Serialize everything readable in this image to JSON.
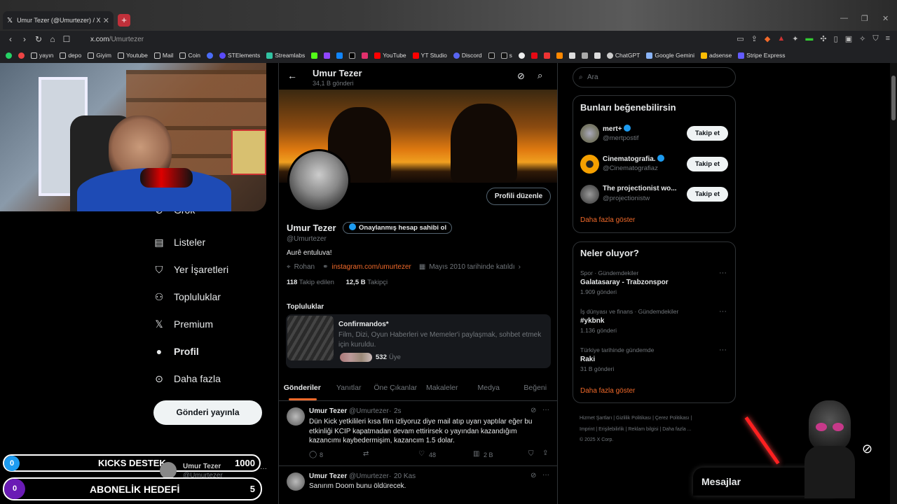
{
  "browser": {
    "tab_title": "Umur Tezer (@Umurtezer) / X",
    "tab_close": "✕",
    "new_tab": "+",
    "url_host": "x.com",
    "url_path": "/Umurtezer",
    "bookmarks": [
      "yayın",
      "depo",
      "Giyim",
      "Youtube",
      "Mail",
      "Coin",
      "STElements",
      "Streamlabs",
      "YouTube",
      "YT Studio",
      "Discord",
      "s",
      "ChatGPT",
      "Google Gemini",
      "adsense",
      "Stripe Express"
    ]
  },
  "nav": {
    "items": [
      {
        "label": "Grok",
        "icon": "grok-icon"
      },
      {
        "label": "Listeler",
        "icon": "list-icon"
      },
      {
        "label": "Yer İşaretleri",
        "icon": "bookmark-icon"
      },
      {
        "label": "Topluluklar",
        "icon": "communities-icon"
      },
      {
        "label": "Premium",
        "icon": "x-logo-icon"
      },
      {
        "label": "Profil",
        "icon": "profile-icon"
      },
      {
        "label": "Daha fazla",
        "icon": "more-icon"
      }
    ],
    "post_button": "Gönderi yayınla"
  },
  "overlay": {
    "kicks_label": "KICKS DESTEK",
    "kicks_current": "0",
    "kicks_goal": "1000",
    "sub_label": "ABONELİK HEDEFİ",
    "sub_current": "0",
    "sub_goal": "5",
    "account_name": "Umur Tezer",
    "account_handle": "@Umurtezer"
  },
  "profile": {
    "header_name": "Umur Tezer",
    "header_posts": "34,1 B gönderi",
    "name": "Umur Tezer",
    "verify_badge": "Onaylanmış hesap sahibi ol",
    "handle": "@Umurtezer",
    "bio": "Aurê entuluva!",
    "location": "Rohan",
    "link": "instagram.com/umurtezer",
    "joined": "Mayıs 2010 tarihinde katıldı",
    "following_count": "118",
    "following_label": "Takip edilen",
    "followers_count": "12,5 B",
    "followers_label": "Takipçi",
    "edit_button": "Profili düzenle",
    "communities_heading": "Topluluklar",
    "community_name": "Confirmandos*",
    "community_desc": "Film, Dizi, Oyun Haberleri ve Memeler'i paylaşmak, sohbet etmek için kuruldu.",
    "community_members": "532",
    "community_members_label": "Üye"
  },
  "tabs": [
    "Gönderiler",
    "Yanıtlar",
    "Öne Çıkanlar",
    "Makaleler",
    "Medya",
    "Beğeni"
  ],
  "tweets": [
    {
      "name": "Umur Tezer",
      "handle": "@Umurtezer",
      "time": "2s",
      "text": "Dün Kick yetkilileri kısa film izliyoruz diye mail atıp uyarı yaptılar eğer bu etkinliği KCIP kapatmadan devam ettirirsek o yayından kazandığım kazancımı kaybedermişim, kazancım 1.5 dolar.",
      "replies": "8",
      "likes": "48",
      "views": "2 B"
    },
    {
      "name": "Umur Tezer",
      "handle": "@Umurtezer",
      "time": "20 Kas",
      "text": "Sanırım Doom bunu öldürecek."
    }
  ],
  "sidebar": {
    "search_placeholder": "Ara",
    "suggest_title": "Bunları beğenebilirsin",
    "suggestions": [
      {
        "name": "mert+",
        "handle": "@mertpostif",
        "button": "Takip et"
      },
      {
        "name": "Cinematografia.",
        "handle": "@Cinematografiaz",
        "button": "Takip et"
      },
      {
        "name": "The projectionist wo...",
        "handle": "@projectionistw",
        "button": "Takip et"
      }
    ],
    "show_more": "Daha fazla göster",
    "trends_title": "Neler oluyor?",
    "trends": [
      {
        "context": "Spor · Gündemdekiler",
        "topic": "Galatasaray - Trabzonspor",
        "count": "1.909 gönderi"
      },
      {
        "context": "İş dünyası ve finans · Gündemdekiler",
        "topic": "#ykbnk",
        "count": "1.136 gönderi"
      },
      {
        "context": "Türkiye tarihinde gündemde",
        "topic": "Raki",
        "count": "31 B gönderi"
      }
    ],
    "show_more_2": "Daha fazla göster",
    "footer_line1": "Hizmet Şartları  |  Gizlilik Politikası  |  Çerez Politikası  |",
    "footer_line2": "Imprint  |  Erişilebilirlik  |  Reklam bilgisi  |  Daha fazla ...",
    "footer_line3": "© 2025 X Corp."
  },
  "messages": {
    "label": "Mesajlar"
  }
}
